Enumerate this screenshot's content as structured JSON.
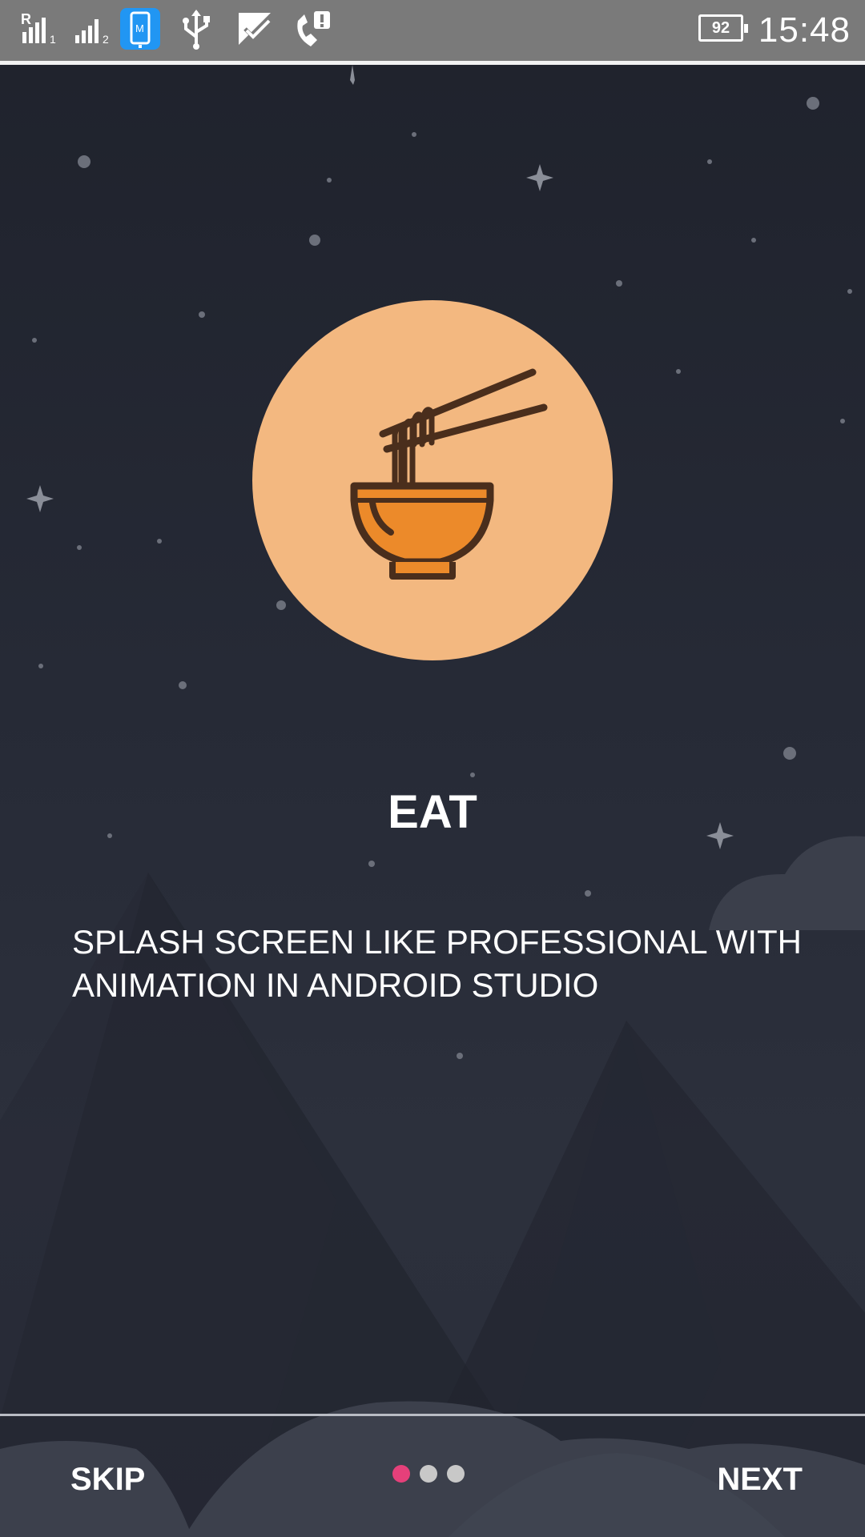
{
  "status_bar": {
    "time": "15:48",
    "battery": "92",
    "sim1_label": "R",
    "sim1_index": "1",
    "sim2_index": "2",
    "icons": [
      "signal-sim1-icon",
      "signal-sim2-icon",
      "phone-app-icon",
      "usb-icon",
      "checkmark-notification-icon",
      "phone-alert-icon"
    ]
  },
  "slide": {
    "icon": "noodle-bowl-icon",
    "title": "EAT",
    "description": "SPLASH SCREEN LIKE PROFESSIONAL WITH ANIMATION IN ANDROID STUDIO",
    "circle_color": "#f3b880"
  },
  "navigation": {
    "skip_label": "SKIP",
    "next_label": "NEXT",
    "page_count": 3,
    "current_page": 1,
    "active_dot_color": "#e5407a"
  }
}
